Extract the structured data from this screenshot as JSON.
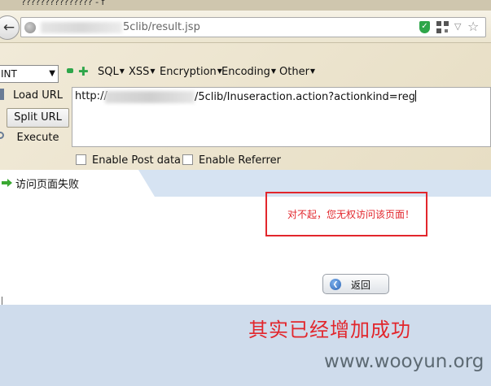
{
  "browser": {
    "tab_title": "??????????????? - f",
    "url_suffix": "5clib/result.jsp"
  },
  "hackbar": {
    "select_value": "INT",
    "menus": [
      "SQL",
      "XSS",
      "Encryption",
      "Encoding",
      "Other"
    ],
    "load_url": "Load URL",
    "split_url": "Split URL",
    "execute": "Execute",
    "url_start": "http://",
    "url_end": "/5clib/Inuseraction.action?actionkind=reg",
    "enable_post": "Enable Post data",
    "enable_referrer": "Enable Referrer"
  },
  "page": {
    "heading": "访问页面失败",
    "error_message": "对不起，您无权访问该页面！",
    "back_button": "返回"
  },
  "annotation": {
    "caption": "其实已经增加成功",
    "watermark": "www.wooyun.org"
  },
  "colors": {
    "error_red": "#e2262c",
    "band_blue": "#d6e3f2",
    "hackbar_bg": "#ece4cd"
  },
  "icons": [
    "back-arrow-icon",
    "globe-icon",
    "shield-icon",
    "qr-code-icon",
    "star-icon",
    "green-arrow-icon",
    "back-icon"
  ]
}
